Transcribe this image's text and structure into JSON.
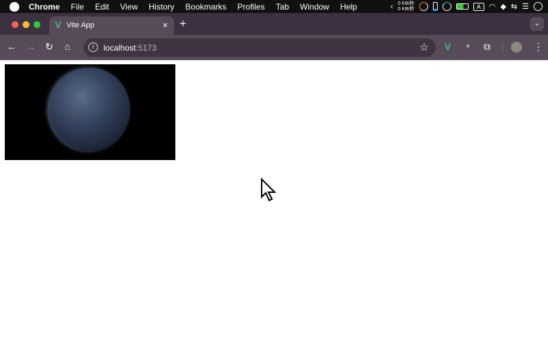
{
  "menubar": {
    "app": "Chrome",
    "items": [
      "File",
      "Edit",
      "View",
      "History",
      "Bookmarks",
      "Profiles",
      "Tab",
      "Window",
      "Help"
    ],
    "net_up": "0 KB/秒",
    "net_down": "0 KB/秒",
    "input_source": "A"
  },
  "tab": {
    "title": "Vite App",
    "favicon": "vue-logo-icon",
    "close": "×",
    "new_tab": "+"
  },
  "toolbar": {
    "url_host": "localhost",
    "url_port": ":5173"
  },
  "colors": {
    "vue": "#42b883",
    "titlebar": "#3b3140",
    "toolbar": "#574b5a"
  },
  "page": {
    "image": "earth-at-night-image"
  }
}
